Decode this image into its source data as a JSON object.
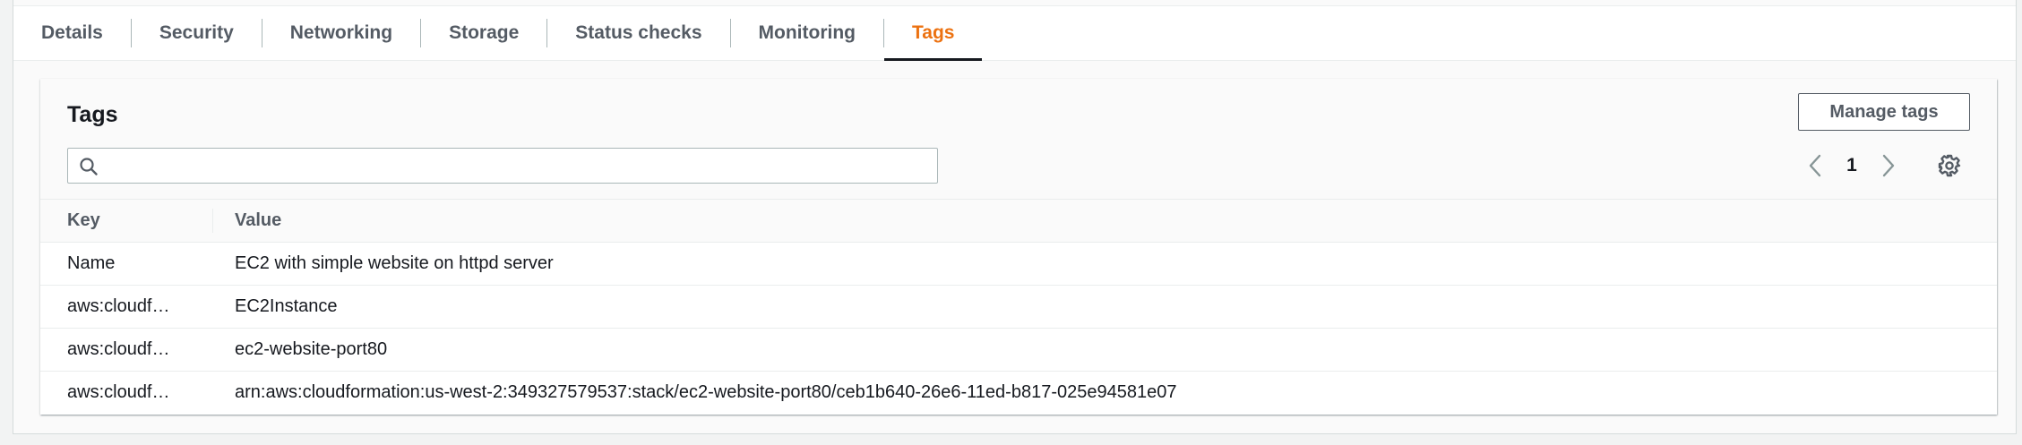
{
  "tabs": [
    {
      "label": "Details",
      "active": false
    },
    {
      "label": "Security",
      "active": false
    },
    {
      "label": "Networking",
      "active": false
    },
    {
      "label": "Storage",
      "active": false
    },
    {
      "label": "Status checks",
      "active": false
    },
    {
      "label": "Monitoring",
      "active": false
    },
    {
      "label": "Tags",
      "active": true
    }
  ],
  "panel": {
    "title": "Tags",
    "manage_label": "Manage tags",
    "search": {
      "value": "",
      "placeholder": ""
    },
    "pagination": {
      "current_page": "1"
    }
  },
  "table": {
    "columns": [
      "Key",
      "Value"
    ],
    "rows": [
      {
        "key": "Name",
        "value": "EC2 with simple website on httpd server"
      },
      {
        "key": "aws:cloudf…",
        "value": "EC2Instance"
      },
      {
        "key": "aws:cloudf…",
        "value": "ec2-website-port80"
      },
      {
        "key": "aws:cloudf…",
        "value": "arn:aws:cloudformation:us-west-2:349327579537:stack/ec2-website-port80/ceb1b640-26e6-11ed-b817-025e94581e07"
      }
    ]
  },
  "icons": {
    "search": "search-icon",
    "prev": "chevron-left-icon",
    "next": "chevron-right-icon",
    "settings": "gear-icon"
  },
  "colors": {
    "active_tab": "#ec7211",
    "tab_text": "#545b64",
    "text": "#16191f",
    "border": "#eaeded"
  }
}
